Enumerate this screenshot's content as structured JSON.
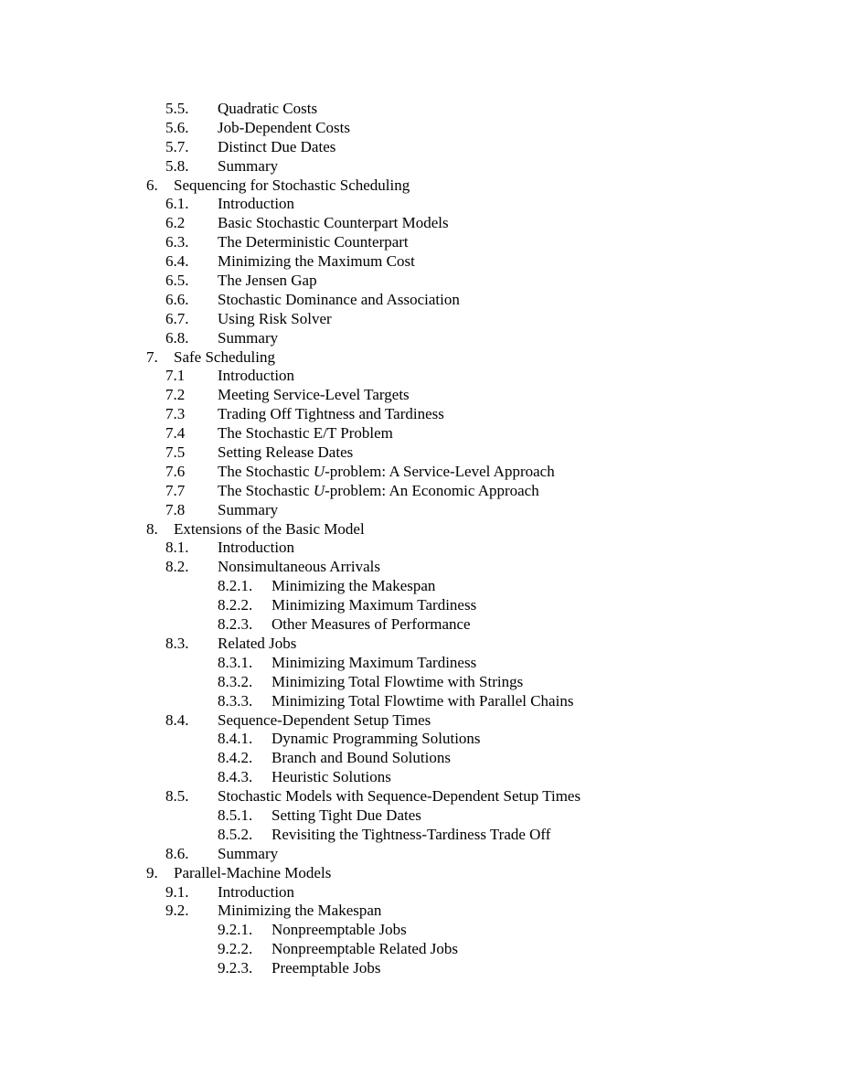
{
  "document": {
    "kind": "table-of-contents",
    "page_background": "#ffffff",
    "text_color": "#000000"
  },
  "toc": {
    "entries": [
      {
        "number": "5.5.",
        "title": "Quadratic Costs",
        "level": 2
      },
      {
        "number": "5.6.",
        "title": "Job-Dependent Costs",
        "level": 2
      },
      {
        "number": "5.7.",
        "title": "Distinct Due Dates",
        "level": 2
      },
      {
        "number": "5.8.",
        "title": "Summary",
        "level": 2
      },
      {
        "number": "6.",
        "title": "Sequencing for Stochastic Scheduling",
        "level": 1
      },
      {
        "number": "6.1.",
        "title": "Introduction",
        "level": 2
      },
      {
        "number": "6.2",
        "title": "Basic Stochastic Counterpart Models",
        "level": 2
      },
      {
        "number": "6.3.",
        "title": "The Deterministic Counterpart",
        "level": 2
      },
      {
        "number": "6.4.",
        "title": "Minimizing the Maximum Cost",
        "level": 2
      },
      {
        "number": "6.5.",
        "title": "The Jensen Gap",
        "level": 2
      },
      {
        "number": "6.6.",
        "title": "Stochastic Dominance and Association",
        "level": 2
      },
      {
        "number": "6.7.",
        "title": "Using Risk Solver",
        "level": 2
      },
      {
        "number": "6.8.",
        "title": "Summary",
        "level": 2
      },
      {
        "number": "7.",
        "title": "Safe Scheduling",
        "level": 1
      },
      {
        "number": "7.1",
        "title": "Introduction",
        "level": 2
      },
      {
        "number": "7.2",
        "title": "Meeting Service-Level Targets",
        "level": 2
      },
      {
        "number": "7.3",
        "title": "Trading Off Tightness and Tardiness",
        "level": 2
      },
      {
        "number": "7.4",
        "title": "The Stochastic E/T Problem",
        "level": 2
      },
      {
        "number": "7.5",
        "title": "Setting Release Dates",
        "level": 2
      },
      {
        "number": "7.6",
        "title": "The Stochastic U-problem: A Service-Level Approach",
        "level": 2,
        "italic_run": "U"
      },
      {
        "number": "7.7",
        "title": "The Stochastic U-problem: An Economic Approach",
        "level": 2,
        "italic_run": "U"
      },
      {
        "number": "7.8",
        "title": "Summary",
        "level": 2
      },
      {
        "number": "8.",
        "title": "Extensions of the Basic Model",
        "level": 1
      },
      {
        "number": "8.1.",
        "title": "Introduction",
        "level": 2
      },
      {
        "number": "8.2.",
        "title": "Nonsimultaneous Arrivals",
        "level": 2
      },
      {
        "number": "8.2.1.",
        "title": "Minimizing the Makespan",
        "level": 3
      },
      {
        "number": "8.2.2.",
        "title": "Minimizing Maximum Tardiness",
        "level": 3
      },
      {
        "number": "8.2.3.",
        "title": "Other Measures of Performance",
        "level": 3
      },
      {
        "number": "8.3.",
        "title": "Related Jobs",
        "level": 2
      },
      {
        "number": "8.3.1.",
        "title": "Minimizing Maximum Tardiness",
        "level": 3
      },
      {
        "number": "8.3.2.",
        "title": "Minimizing Total Flowtime with Strings",
        "level": 3
      },
      {
        "number": "8.3.3.",
        "title": "Minimizing Total Flowtime with Parallel Chains",
        "level": 3
      },
      {
        "number": "8.4.",
        "title": "Sequence-Dependent Setup Times",
        "level": 2
      },
      {
        "number": "8.4.1.",
        "title": "Dynamic Programming Solutions",
        "level": 3
      },
      {
        "number": "8.4.2.",
        "title": "Branch and Bound Solutions",
        "level": 3
      },
      {
        "number": "8.4.3.",
        "title": "Heuristic Solutions",
        "level": 3
      },
      {
        "number": "8.5.",
        "title": "Stochastic Models with Sequence-Dependent Setup Times",
        "level": 2
      },
      {
        "number": "8.5.1.",
        "title": "Setting Tight Due Dates",
        "level": 3
      },
      {
        "number": "8.5.2.",
        "title": "Revisiting the Tightness-Tardiness Trade Off",
        "level": 3
      },
      {
        "number": "8.6.",
        "title": "Summary",
        "level": 2
      },
      {
        "number": "9.",
        "title": "Parallel-Machine Models",
        "level": 1
      },
      {
        "number": "9.1.",
        "title": "Introduction",
        "level": 2
      },
      {
        "number": "9.2.",
        "title": "Minimizing the Makespan",
        "level": 2
      },
      {
        "number": "9.2.1.",
        "title": "Nonpreemptable Jobs",
        "level": 3
      },
      {
        "number": "9.2.2.",
        "title": "Nonpreemptable Related Jobs",
        "level": 3
      },
      {
        "number": "9.2.3.",
        "title": "Preemptable Jobs",
        "level": 3
      }
    ]
  }
}
